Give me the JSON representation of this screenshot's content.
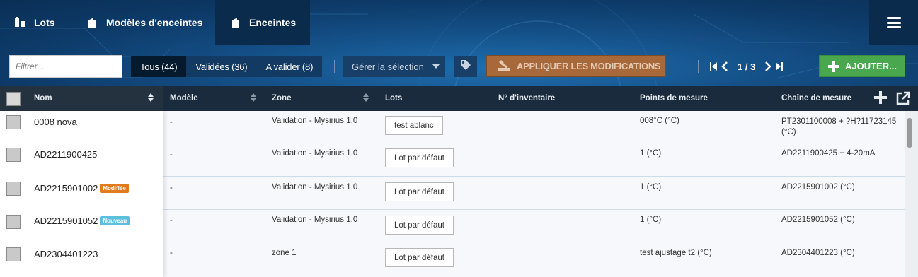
{
  "nav": {
    "tabs": [
      {
        "label": "Lots",
        "icon": "lots-icon"
      },
      {
        "label": "Modèles d'enceintes",
        "icon": "enclosure-model-icon"
      },
      {
        "label": "Enceintes",
        "icon": "enclosure-icon",
        "active": true
      }
    ],
    "menu_icon": "hamburger-menu-icon"
  },
  "toolbar": {
    "filter_placeholder": "Filtrer...",
    "filters": {
      "all": "Tous (44)",
      "validated": "Validées (36)",
      "to_validate": "A valider (8)"
    },
    "manage_selection": "Gérer la sélection",
    "tag_icon": "tag-icon",
    "apply_label": "APPLIQUER LES MODIFICATIONS",
    "pagination": "1 / 3",
    "add_label": "AJOUTER..."
  },
  "table": {
    "columns": {
      "name": "Nom",
      "model": "Modèle",
      "zone": "Zone",
      "lots": "Lots",
      "inventory": "N° d'inventaire",
      "points": "Points de mesure",
      "chain": "Chaîne de mesure"
    },
    "rows": [
      {
        "name": "0008 nova",
        "badge": "",
        "model": "-",
        "zone": "Validation - Mysirius 1.0",
        "lot": "test ablanc",
        "inventory": "",
        "points": "008°C (°C)",
        "chain": "PT2301100008 + ?H?11723145 (°C)"
      },
      {
        "name": "AD2211900425",
        "badge": "",
        "model": "-",
        "zone": "Validation - Mysirius 1.0",
        "lot": "Lot par défaut",
        "inventory": "",
        "points": "1 (°C)",
        "chain": "AD2211900425 + 4-20mA"
      },
      {
        "name": "AD2215901002",
        "badge": "Modifiée",
        "model": "-",
        "zone": "Validation - Mysirius 1.0",
        "lot": "Lot par défaut",
        "inventory": "",
        "points": "1 (°C)",
        "chain": "AD2215901002 (°C)"
      },
      {
        "name": "AD2215901052",
        "badge": "Nouveau",
        "model": "-",
        "zone": "Validation - Mysirius 1.0",
        "lot": "Lot par défaut",
        "inventory": "",
        "points": "1 (°C)",
        "chain": "AD2215901052 (°C)"
      },
      {
        "name": "AD2304401223",
        "badge": "",
        "model": "-",
        "zone": "zone 1",
        "lot": "Lot par défaut",
        "inventory": "",
        "points": "test ajustage t2 (°C)",
        "chain": "AD2304401223 (°C)"
      }
    ]
  },
  "colors": {
    "apply": "#a8693a",
    "add": "#49a84d",
    "badge_modified": "#e07b1e",
    "badge_new": "#5dbfe0"
  }
}
